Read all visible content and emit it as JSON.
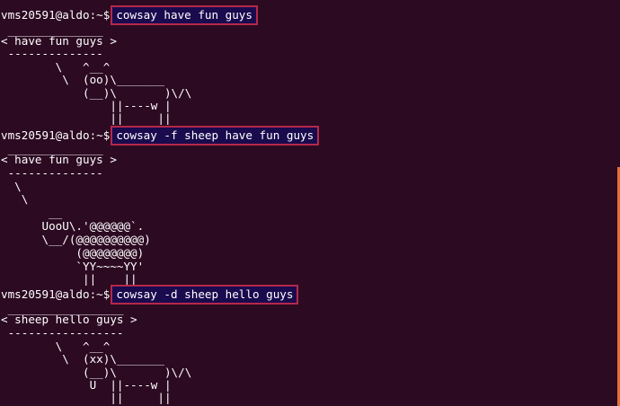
{
  "terminal": {
    "blocks": [
      {
        "prompt": "vms20591@aldo:~$",
        "command": "cowsay have fun guys",
        "output": [
          " ______________",
          "< have fun guys >",
          " --------------",
          "        \\   ^__^",
          "         \\  (oo)\\_______",
          "            (__)\\       )\\/\\",
          "                ||----w |",
          "                ||     ||"
        ]
      },
      {
        "prompt": "vms20591@aldo:~$",
        "command": "cowsay -f sheep have fun guys",
        "output": [
          " ______________",
          "< have fun guys >",
          " --------------",
          "  \\",
          "   \\",
          "       __",
          "      UooU\\.'@@@@@@`.",
          "      \\__/(@@@@@@@@@@)",
          "           (@@@@@@@@)",
          "           `YY~~~~YY'",
          "            ||    ||"
        ]
      },
      {
        "prompt": "vms20591@aldo:~$",
        "command": "cowsay -d sheep hello guys",
        "output": [
          " _________________",
          "< sheep hello guys >",
          " -----------------",
          "        \\   ^__^",
          "         \\  (xx)\\_______",
          "            (__)\\       )\\/\\",
          "             U  ||----w |",
          "                ||     ||"
        ]
      }
    ]
  },
  "colors": {
    "background": "#2c0a22",
    "text": "#ffffff",
    "highlight_border": "#b5284a",
    "highlight_fill": "#1a0a4e",
    "scrollbar": "#e76d38"
  }
}
